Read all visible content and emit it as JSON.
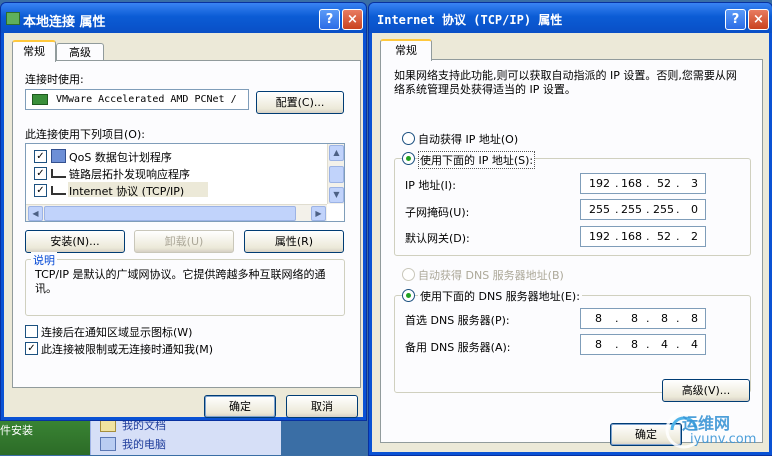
{
  "desktop": {
    "left_label": "件安装",
    "explorer_items": [
      "我的文档",
      "我的电脑"
    ]
  },
  "left_window": {
    "title": "本地连接 属性",
    "help_glyph": "?",
    "close_glyph": "×",
    "tabs": [
      "常规",
      "高级"
    ],
    "connect_using_label": "连接时使用:",
    "adapter_name": "VMware Accelerated AMD PCNet /",
    "configure_button": "配置(C)...",
    "items_label": "此连接使用下列项目(O):",
    "items": [
      {
        "label": "QoS 数据包计划程序",
        "checked": true
      },
      {
        "label": "链路层拓扑发现响应程序",
        "checked": true
      },
      {
        "label": "Internet 协议 (TCP/IP)",
        "checked": true
      }
    ],
    "install_button": "安装(N)...",
    "uninstall_button": "卸载(U)",
    "properties_button": "属性(R)",
    "description_title": "说明",
    "description_text": "TCP/IP 是默认的广域网协议。它提供跨越多种互联网络的通讯。",
    "show_icon_label": "连接后在通知区域显示图标(W)",
    "show_icon_checked": false,
    "notify_label": "此连接被限制或无连接时通知我(M)",
    "notify_checked": true,
    "ok_button": "确定",
    "cancel_button": "取消"
  },
  "right_window": {
    "title": "Internet 协议 (TCP/IP) 属性",
    "help_glyph": "?",
    "close_glyph": "×",
    "tab": "常规",
    "intro": "如果网络支持此功能,则可以获取自动指派的 IP 设置。否则,您需要从网络系统管理员处获得适当的 IP 设置。",
    "auto_ip_label": "自动获得 IP 地址(O)",
    "manual_ip_label": "使用下面的 IP 地址(S):",
    "ip_address_label": "IP 地址(I):",
    "ip_address": [
      "192",
      "168",
      "52",
      "3"
    ],
    "subnet_label": "子网掩码(U):",
    "subnet_mask": [
      "255",
      "255",
      "255",
      "0"
    ],
    "gateway_label": "默认网关(D):",
    "gateway": [
      "192",
      "168",
      "52",
      "2"
    ],
    "auto_dns_label": "自动获得 DNS 服务器地址(B)",
    "manual_dns_label": "使用下面的 DNS 服务器地址(E):",
    "preferred_dns_label": "首选 DNS 服务器(P):",
    "preferred_dns": [
      "8",
      "8",
      "8",
      "8"
    ],
    "alternate_dns_label": "备用 DNS 服务器(A):",
    "alternate_dns": [
      "8",
      "8",
      "4",
      "4"
    ],
    "advanced_button": "高级(V)...",
    "ok_button": "确定",
    "selected_ip_mode": "manual",
    "selected_dns_mode": "manual"
  },
  "watermark": {
    "top": "运维网",
    "bottom": "iyunv.com"
  },
  "colors": {
    "titlebar": "#0b5cd5",
    "face": "#ece9d8",
    "panel": "#fcfcfe",
    "accent_tab": "#ffc83c",
    "radio_dot": "#21a121"
  }
}
